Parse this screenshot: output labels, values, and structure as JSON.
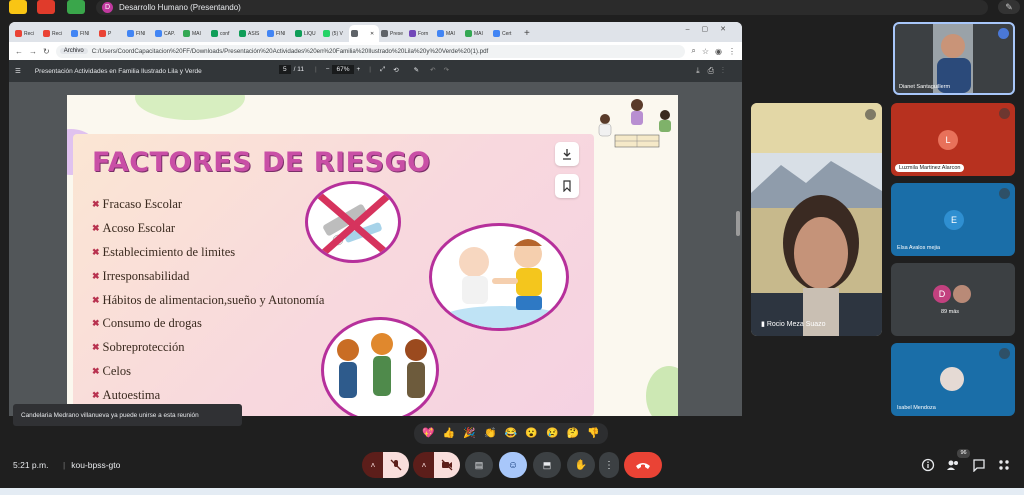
{
  "meet": {
    "presentation_chip": "Desarrollo Humano (Presentando)",
    "presenter_initial": "D",
    "time": "5:21 p.m.",
    "meeting_code": "kou-bpss-gto",
    "toast": "Candelaria Medrano villanueva ya puede unirse a esta reunión",
    "participants_badge": "96"
  },
  "browser": {
    "tabs": [
      {
        "label": "Reci",
        "color": "#ea4335"
      },
      {
        "label": "Reci",
        "color": "#ea4335"
      },
      {
        "label": "FINI",
        "color": "#4285f4"
      },
      {
        "label": "P",
        "color": "#ea4335"
      },
      {
        "label": "FINI",
        "color": "#4285f4"
      },
      {
        "label": "CAP.",
        "color": "#4285f4"
      },
      {
        "label": "MAI",
        "color": "#34a853"
      },
      {
        "label": "conf",
        "color": "#0f9d58"
      },
      {
        "label": "ASIS",
        "color": "#0f9d58"
      },
      {
        "label": "FINI",
        "color": "#4285f4"
      },
      {
        "label": "LIQU",
        "color": "#0f9d58"
      },
      {
        "label": "(5) V",
        "color": "#25d366"
      },
      {
        "label": "",
        "color": "#5f6368"
      },
      {
        "label": "Prese",
        "color": "#5f6368"
      },
      {
        "label": "Forn",
        "color": "#7248b9"
      },
      {
        "label": "MAI",
        "color": "#4285f4"
      },
      {
        "label": "MAI",
        "color": "#34a853"
      },
      {
        "label": "Cert",
        "color": "#4285f4"
      }
    ],
    "address_chip": "Archivo",
    "url": "C:/Users/CoordCapacitacion%20FF/Downloads/Presentación%20Actividades%20en%20Familia%20Ilustrado%20Lila%20y%20Verde%20(1).pdf",
    "pdf_title": "Presentación Actividades en Familia Ilustrado Lila y Verde",
    "page_current": "5",
    "page_total": "/ 11",
    "zoom": "67%"
  },
  "slide": {
    "title": "FACTORES DE RIESGO",
    "items": [
      "Fracaso Escolar",
      "Acoso Escolar",
      "Establecimiento de limites",
      "Irresponsabilidad",
      "Hábitos de alimentacion,sueño y Autonomía",
      "Consumo de drogas",
      "Sobreprotección",
      "Celos",
      "Autoestima"
    ]
  },
  "participants": {
    "top": "Dianet Santaguillerm",
    "main": "Rocio Meza Suazo",
    "tile2": "Luzmila Martinez Alarcon",
    "tile2_initial": "L",
    "tile3": "Elsa Avalos mejia",
    "tile3_initial": "E",
    "tile4_count": "89 más",
    "tile4_initial": "D",
    "tile5": "Isabel Mendoza"
  },
  "reactions": [
    "💖",
    "👍",
    "🎉",
    "👏",
    "😂",
    "😮",
    "😢",
    "🤔",
    "👎"
  ],
  "colors": {
    "accent": "#c94fa6",
    "end_call": "#ea4335",
    "tile_red": "#b7311f",
    "tile_blue": "#1a6ea8"
  }
}
